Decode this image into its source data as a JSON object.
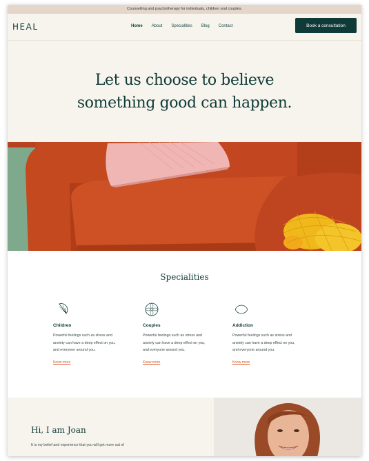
{
  "announcement": "Counselling and psychotherapy for individuals, children and couples.",
  "header": {
    "logo": "HEAL",
    "nav": [
      "Home",
      "About",
      "Specialities",
      "Blog",
      "Contact"
    ],
    "active_nav": "Home",
    "cta_label": "Book a consultation"
  },
  "hero": {
    "line1": "Let us choose to believe",
    "line2": "something good can happen."
  },
  "colors": {
    "brand_dark": "#0f3a37",
    "sofa_orange": "#c0431f",
    "link_orange": "#d45a2b",
    "announcement_bg": "#e4d6ca",
    "cream": "#f7f4ee"
  },
  "specialities": {
    "title": "Specialities",
    "items": [
      {
        "icon": "citrus-slice-icon",
        "title": "Children",
        "desc_1": "Powerful feelings such as stress and",
        "desc_2": "anxiety can have a deep effect on you,",
        "desc_3": "and everyone around you.",
        "link": "Know more"
      },
      {
        "icon": "mandala-icon",
        "title": "Couples",
        "desc_1": "Powerful feelings such as stress and",
        "desc_2": "anxiety can have a deep effect on you,",
        "desc_3": "and everyone around you.",
        "link": "Know more"
      },
      {
        "icon": "leaf-lemon-icon",
        "title": "Addiction",
        "desc_1": "Powerful feelings such as stress and",
        "desc_2": "anxiety can have a deep effect on you,",
        "desc_3": "and everyone around you.",
        "link": "Know more"
      }
    ]
  },
  "about": {
    "title": "Hi, I am Joan",
    "intro": "It is my belief and experience that you will get more out of"
  }
}
